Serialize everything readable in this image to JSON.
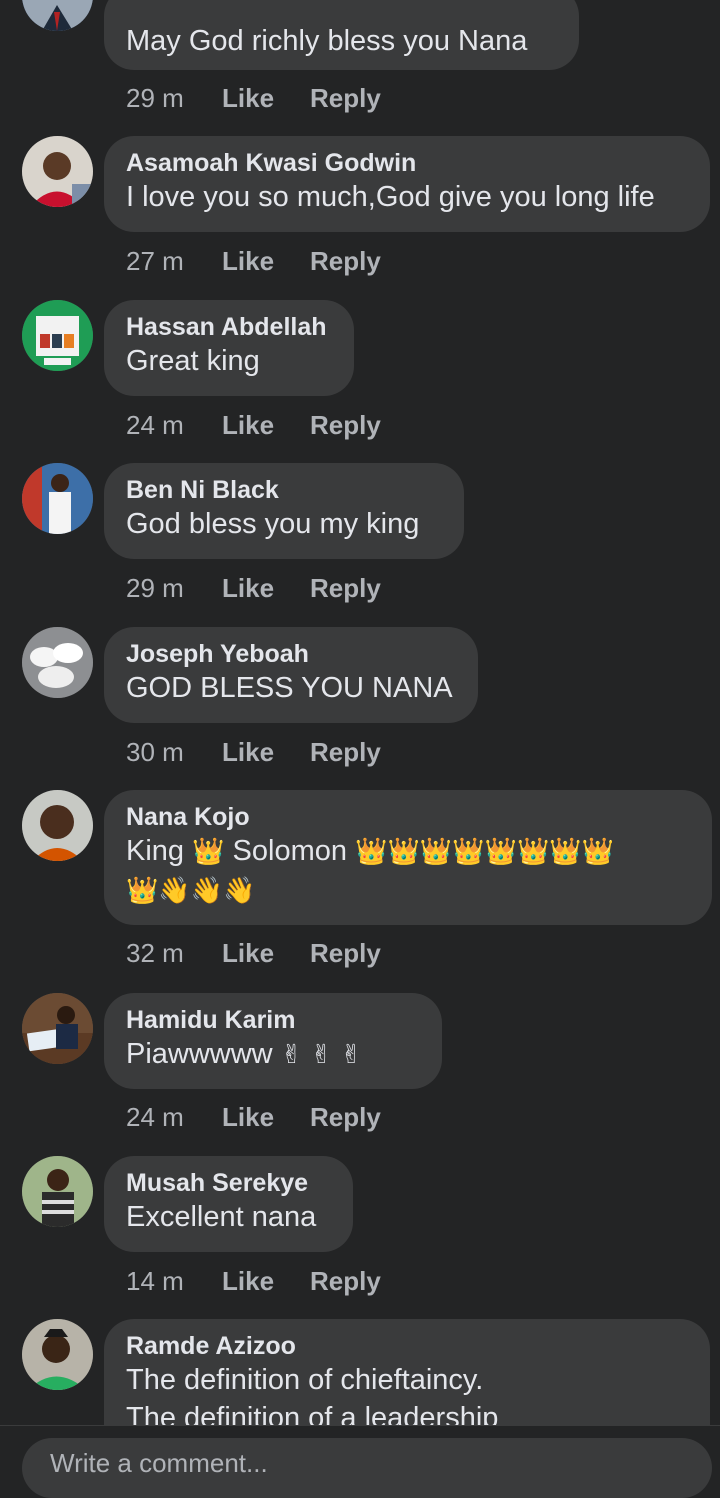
{
  "comments": [
    {
      "author": "",
      "text": "May God richly bless you Nana",
      "time": "29 m",
      "like": "Like",
      "reply": "Reply"
    },
    {
      "author": "Asamoah Kwasi Godwin",
      "text": "I love you so much,God give you long life",
      "time": "27 m",
      "like": "Like",
      "reply": "Reply"
    },
    {
      "author": "Hassan Abdellah",
      "text": "Great king",
      "time": "24 m",
      "like": "Like",
      "reply": "Reply"
    },
    {
      "author": "Ben Ni Black",
      "text": "God bless you my king",
      "time": "29 m",
      "like": "Like",
      "reply": "Reply"
    },
    {
      "author": "Joseph Yeboah",
      "text": "GOD BLESS YOU NANA",
      "time": "30 m",
      "like": "Like",
      "reply": "Reply"
    },
    {
      "author": "Nana Kojo",
      "text_line1_a": "King ",
      "text_line1_b": " Solomon ",
      "emoji_crown": "👑",
      "emoji_wave": "👋",
      "time": "32 m",
      "like": "Like",
      "reply": "Reply"
    },
    {
      "author": "Hamidu Karim",
      "text": "Piawwwww ",
      "emoji_victory": "✌",
      "time": "24 m",
      "like": "Like",
      "reply": "Reply"
    },
    {
      "author": "Musah Serekye",
      "text": "Excellent nana",
      "time": "14 m",
      "like": "Like",
      "reply": "Reply"
    },
    {
      "author": "Ramde Azizoo",
      "text_line1": "The definition of chieftaincy.",
      "text_line2": "The definition of a leadership"
    }
  ],
  "composer": {
    "placeholder": "Write a comment..."
  },
  "colors": {
    "background": "#232425",
    "bubble": "#3a3b3c",
    "primary_text": "#e4e6eb",
    "secondary_text": "#b0b3b8"
  }
}
